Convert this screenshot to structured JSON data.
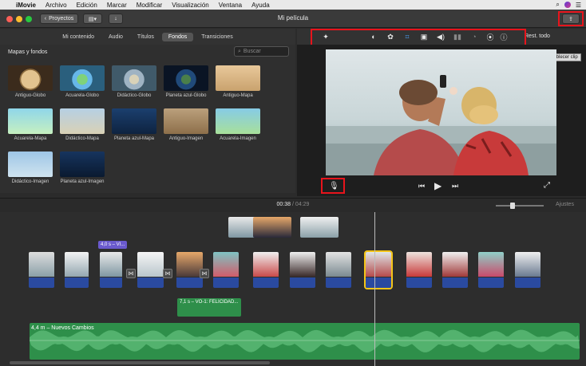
{
  "menubar": {
    "app": "iMovie",
    "items": [
      "Archivo",
      "Edición",
      "Marcar",
      "Modificar",
      "Visualización",
      "Ventana",
      "Ayuda"
    ]
  },
  "titlebar": {
    "title": "Mi película",
    "projects_label": "Proyectos"
  },
  "browser": {
    "tabs": [
      "Mi contenido",
      "Audio",
      "Títulos",
      "Fondos",
      "Transiciones"
    ],
    "active_tab": "Fondos",
    "section_title": "Mapas y fondos",
    "search_placeholder": "Buscar",
    "items": [
      {
        "label": "Antiguo-Globo",
        "style": "globe-old"
      },
      {
        "label": "Acuarela-Globo",
        "style": "globe-water"
      },
      {
        "label": "Didáctico-Globo",
        "style": "globe-edu"
      },
      {
        "label": "Planeta azul-Globo",
        "style": "globe-blue"
      },
      {
        "label": "Antiguo-Mapa",
        "style": "map-old"
      },
      {
        "label": "Acuarela-Mapa",
        "style": "map-water"
      },
      {
        "label": "Didáctico-Mapa",
        "style": "map-edu"
      },
      {
        "label": "Planeta azul-Mapa",
        "style": "map-blue"
      },
      {
        "label": "Antiguo-Imagen",
        "style": "img-old"
      },
      {
        "label": "Acuarela-Imagen",
        "style": "img-water"
      },
      {
        "label": "Didáctico-Imagen",
        "style": "img-edu"
      },
      {
        "label": "Planeta azul-Imagen",
        "style": "img-blue"
      }
    ]
  },
  "viewer": {
    "reset_all": "Rest. todo",
    "tooltip": "Restablecer clip",
    "tools": [
      "magic-wand-icon",
      "color-balance-icon",
      "color-correction-icon",
      "crop-icon",
      "stabilization-icon",
      "volume-icon",
      "noise-reduction-icon",
      "speed-icon",
      "clip-filter-icon",
      "info-icon"
    ]
  },
  "timeline": {
    "current_time": "00:38",
    "separator": "/",
    "total_time": "04:29",
    "settings_label": "Ajustes",
    "title_tag": "4,0 s – VI...",
    "voiceover_tag": "7,1 s – VO-1: FELICIDAD...",
    "music_label": "4,4 m – Nuevos Cambios"
  },
  "colors": {
    "highlight_red": "#e8141c",
    "audio_blue": "#2a4aa0",
    "music_green": "#2e8f4a",
    "title_purple": "#6a5acd",
    "selected_clip": "#f5c518"
  }
}
